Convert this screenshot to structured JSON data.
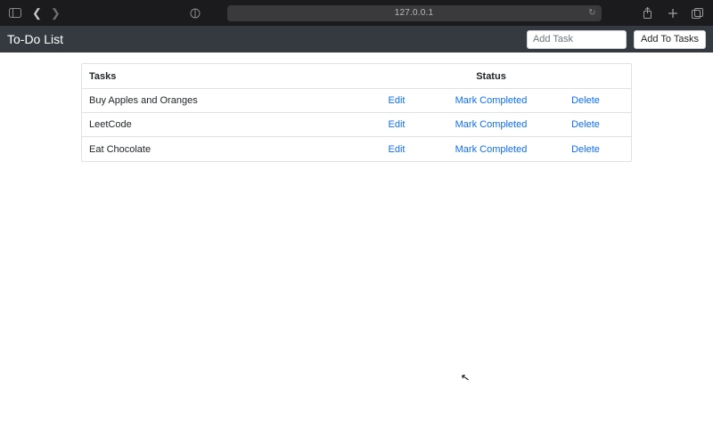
{
  "browser": {
    "address": "127.0.0.1"
  },
  "app": {
    "title": "To-Do List",
    "add_input_placeholder": "Add Task",
    "add_button_label": "Add To Tasks"
  },
  "table": {
    "headers": {
      "tasks": "Tasks",
      "status": "Status"
    },
    "actions": {
      "edit": "Edit",
      "mark": "Mark Completed",
      "delete": "Delete"
    },
    "rows": [
      {
        "task": "Buy Apples and Oranges"
      },
      {
        "task": "LeetCode"
      },
      {
        "task": "Eat Chocolate"
      }
    ]
  }
}
